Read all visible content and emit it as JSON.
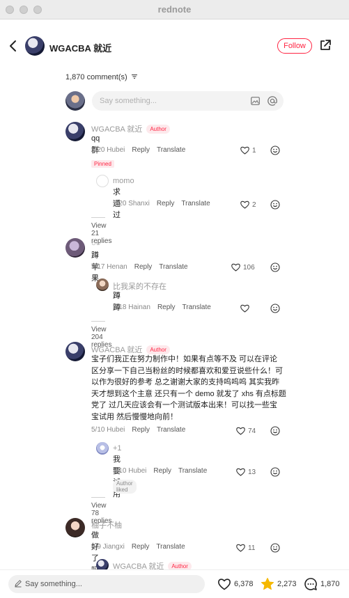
{
  "window": {
    "title": "rednote"
  },
  "header": {
    "author_name": "WGACBA 就近",
    "follow_label": "Follow"
  },
  "comments_count": "1,870 comment(s)",
  "comment_input": {
    "placeholder": "Say something..."
  },
  "badges": {
    "author": "Author",
    "pinned": "Pinned",
    "author_liked": "Author liked"
  },
  "comments": [
    {
      "name": "WGACBA 就近",
      "text": "qq群",
      "date": "5/20 Hubei",
      "reply": "Reply",
      "translate": "Translate",
      "likes": "1",
      "replies": [
        {
          "name": "momo",
          "text": "求通过",
          "date": "5/20 Shanxi",
          "reply": "Reply",
          "translate": "Translate",
          "likes": "2"
        }
      ],
      "view_more": "View 21 replies"
    },
    {
      "name": "○○",
      "text": "蹲苹果",
      "date": "5/17 Henan",
      "reply": "Reply",
      "translate": "Translate",
      "likes": "106",
      "replies": [
        {
          "name": "比我呆的不存在",
          "text": "蹲蹲",
          "date": "5/18 Hainan",
          "reply": "Reply",
          "translate": "Translate",
          "likes": ""
        }
      ],
      "view_more": "View 204 replies"
    },
    {
      "name": "WGACBA 就近",
      "text_lines": [
        "宝子们我正在努力制作中！如果有点等不及 可以在评论",
        "区分享一下自己当粉丝的时候都喜欢和爱豆说些什么！可",
        "以作为很好的参考 总之谢谢大家的支持呜呜呜 其实我昨",
        "天才想到这个主意 还只有一个 demo 就发了 xhs 有点标题",
        "党了 过几天应该会有一个测试版本出来！可以找一些宝",
        "宝试用 然后慢慢地向前！"
      ],
      "date": "5/10 Hubei",
      "reply": "Reply",
      "translate": "Translate",
      "likes": "74",
      "replies": [
        {
          "name": "+1",
          "text": "我要试用",
          "date": "5/10 Hubei",
          "reply": "Reply",
          "translate": "Translate",
          "likes": "13"
        }
      ],
      "view_more": "View 78 replies"
    },
    {
      "name": "柚子不柚",
      "text": "做好了吗",
      "date": "5/9 Jiangxi",
      "reply": "Reply",
      "translate": "Translate",
      "likes": "11",
      "replies": [
        {
          "name": "WGACBA 就近"
        }
      ]
    }
  ],
  "bottom_bar": {
    "placeholder": "Say something...",
    "likes": "6,378",
    "collects": "2,273",
    "comments": "1,870"
  },
  "colors": {
    "accent": "#ff2442",
    "star": "#f5b800"
  }
}
